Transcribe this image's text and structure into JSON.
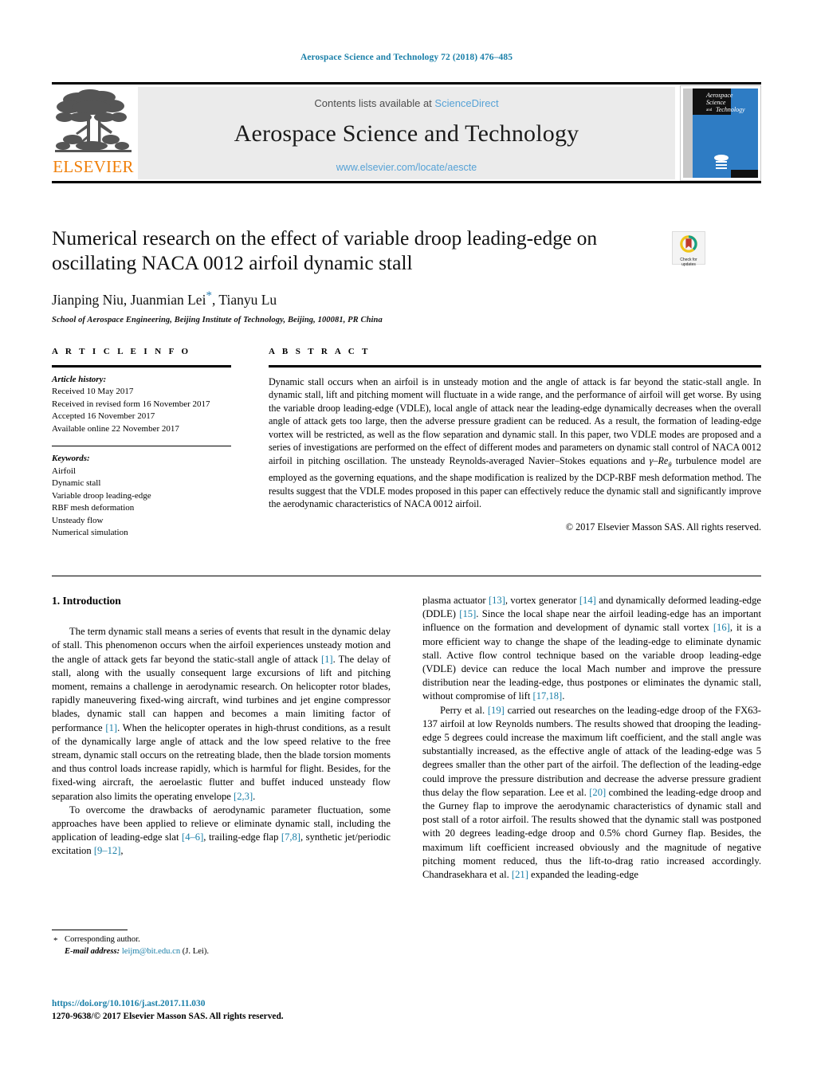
{
  "running_head": "Aerospace Science and Technology 72 (2018) 476–485",
  "masthead": {
    "publisher_name": "ELSEVIER",
    "contents_prefix": "Contents lists available at ",
    "contents_link": "ScienceDirect",
    "journal_title": "Aerospace Science and Technology",
    "journal_url": "www.elsevier.com/locate/aescte",
    "cover_title_line1": "Aerospace",
    "cover_title_line2": "Science",
    "cover_title_line3": "and",
    "cover_title_line4": "Technology",
    "link_color": "#56a2d6",
    "band_color": "#ebebeb",
    "elsevier_orange": "#F07F09"
  },
  "title_block": {
    "title": "Numerical research on the effect of variable droop leading-edge on oscillating NACA 0012 airfoil dynamic stall",
    "authors_pre": "Jianping Niu, Juanmian Lei",
    "authors_star": "*",
    "authors_post": ", Tianyu Lu",
    "affiliation": "School of Aerospace Engineering, Beijing Institute of Technology, Beijing, 100081, PR China",
    "crossmark_line1": "Check for",
    "crossmark_line2": "updates"
  },
  "article_info": {
    "heading": "A R T I C L E    I N F O",
    "history_label": "Article history:",
    "history": [
      "Received 10 May 2017",
      "Received in revised form 16 November 2017",
      "Accepted 16 November 2017",
      "Available online 22 November 2017"
    ],
    "keywords_label": "Keywords:",
    "keywords": [
      "Airfoil",
      "Dynamic stall",
      "Variable droop leading-edge",
      "RBF mesh deformation",
      "Unsteady flow",
      "Numerical simulation"
    ]
  },
  "abstract": {
    "heading": "A B S T R A C T",
    "part1": "Dynamic stall occurs when an airfoil is in unsteady motion and the angle of attack is far beyond the static-stall angle. In dynamic stall, lift and pitching moment will fluctuate in a wide range, and the performance of airfoil will get worse. By using the variable droop leading-edge (VDLE), local angle of attack near the leading-edge dynamically decreases when the overall angle of attack gets too large, then the adverse pressure gradient can be reduced. As a result, the formation of leading-edge vortex will be restricted, as well as the flow separation and dynamic stall. In this paper, two VDLE modes are proposed and a series of investigations are performed on the effect of different modes and parameters on dynamic stall control of NACA 0012 airfoil in pitching oscillation. The unsteady Reynolds-averaged Navier–Stokes equations and ",
    "math_gamma": "γ",
    "math_dash": "–",
    "math_re": "Re",
    "math_theta": "θ",
    "part2": " turbulence model are employed as the governing equations, and the shape modification is realized by the DCP-RBF mesh deformation method. The results suggest that the VDLE modes proposed in this paper can effectively reduce the dynamic stall and significantly improve the aerodynamic characteristics of NACA 0012 airfoil.",
    "rights": "© 2017 Elsevier Masson SAS. All rights reserved."
  },
  "body": {
    "section_heading": "1. Introduction",
    "left_paragraphs": [
      {
        "indent": true,
        "runs": [
          {
            "t": "The term dynamic stall means a series of events that result in the dynamic delay of stall. This phenomenon occurs when the airfoil experiences unsteady motion and the angle of attack gets far beyond the static-stall angle of attack "
          },
          {
            "t": "[1]",
            "ref": true
          },
          {
            "t": ". The delay of stall, along with the usually consequent large excursions of lift and pitching moment, remains a challenge in aerodynamic research. On helicopter rotor blades, rapidly maneuvering fixed-wing aircraft, wind turbines and jet engine compressor blades, dynamic stall can happen and becomes a main limiting factor of performance "
          },
          {
            "t": "[1]",
            "ref": true
          },
          {
            "t": ". When the helicopter operates in high-thrust conditions, as a result of the dynamically large angle of attack and the low speed relative to the free stream, dynamic stall occurs on the retreating blade, then the blade torsion moments and thus control loads increase rapidly, which is harmful for flight. Besides, for the fixed-wing aircraft, the aeroelastic flutter and buffet induced unsteady flow separation also limits the operating envelope "
          },
          {
            "t": "[2,3]",
            "ref": true
          },
          {
            "t": "."
          }
        ]
      },
      {
        "indent": true,
        "runs": [
          {
            "t": "To overcome the drawbacks of aerodynamic parameter fluctuation, some approaches have been applied to relieve or eliminate dynamic stall, including the application of leading-edge slat "
          },
          {
            "t": "[4–6]",
            "ref": true
          },
          {
            "t": ", trailing-edge flap "
          },
          {
            "t": "[7,8]",
            "ref": true
          },
          {
            "t": ", synthetic jet/periodic excitation "
          },
          {
            "t": "[9–12]",
            "ref": true
          },
          {
            "t": ","
          }
        ]
      }
    ],
    "right_paragraphs": [
      {
        "indent": false,
        "runs": [
          {
            "t": "plasma actuator "
          },
          {
            "t": "[13]",
            "ref": true
          },
          {
            "t": ", vortex generator "
          },
          {
            "t": "[14]",
            "ref": true
          },
          {
            "t": " and dynamically deformed leading-edge (DDLE) "
          },
          {
            "t": "[15]",
            "ref": true
          },
          {
            "t": ". Since the local shape near the airfoil leading-edge has an important influence on the formation and development of dynamic stall vortex "
          },
          {
            "t": "[16]",
            "ref": true
          },
          {
            "t": ", it is a more efficient way to change the shape of the leading-edge to eliminate dynamic stall. Active flow control technique based on the variable droop leading-edge (VDLE) device can reduce the local Mach number and improve the pressure distribution near the leading-edge, thus postpones or eliminates the dynamic stall, without compromise of lift "
          },
          {
            "t": "[17,18]",
            "ref": true
          },
          {
            "t": "."
          }
        ]
      },
      {
        "indent": true,
        "runs": [
          {
            "t": "Perry et al. "
          },
          {
            "t": "[19]",
            "ref": true
          },
          {
            "t": " carried out researches on the leading-edge droop of the FX63-137 airfoil at low Reynolds numbers. The results showed that drooping the leading-edge 5 degrees could increase the maximum lift coefficient, and the stall angle was substantially increased, as the effective angle of attack of the leading-edge was 5 degrees smaller than the other part of the airfoil. The deflection of the leading-edge could improve the pressure distribution and decrease the adverse pressure gradient thus delay the flow separation. Lee et al. "
          },
          {
            "t": "[20]",
            "ref": true
          },
          {
            "t": " combined the leading-edge droop and the Gurney flap to improve the aerodynamic characteristics of dynamic stall and post stall of a rotor airfoil. The results showed that the dynamic stall was postponed with 20 degrees leading-edge droop and 0.5% chord Gurney flap. Besides, the maximum lift coefficient increased obviously and the magnitude of negative pitching moment reduced, thus the lift-to-drag ratio increased accordingly. Chandrasekhara et al. "
          },
          {
            "t": "[21]",
            "ref": true
          },
          {
            "t": " expanded the leading-edge"
          }
        ]
      }
    ]
  },
  "footnote": {
    "star": "*",
    "corresponding": "Corresponding author.",
    "email_label": "E-mail address:",
    "email": "leijm@bit.edu.cn",
    "email_suffix": "(J. Lei)."
  },
  "colophon": {
    "doi": "https://doi.org/10.1016/j.ast.2017.11.030",
    "issn_line": "1270-9638/© 2017 Elsevier Masson SAS. All rights reserved."
  }
}
